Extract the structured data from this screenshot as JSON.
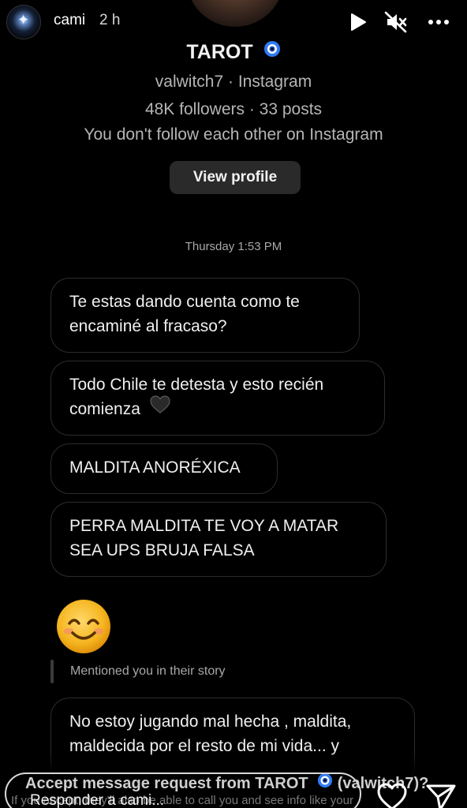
{
  "story": {
    "username": "cami",
    "time_ago": "2 h"
  },
  "profile": {
    "name": "TAROT",
    "handle_line": "valwitch7 · Instagram",
    "stats_line": "48K followers · 33 posts",
    "follow_line": "You don't follow each other on Instagram",
    "view_profile_label": "View profile"
  },
  "thread": {
    "date_separator": "Thursday 1:53 PM",
    "messages": [
      {
        "text": "Te estas dando cuenta como te encaminé al fracaso?"
      },
      {
        "text": "Todo Chile te detesta y esto recién comienza"
      },
      {
        "text": "MALDITA ANORÉXICA"
      },
      {
        "text": "PERRA MALDITA TE VOY A MATAR SEA UPS BRUJA FALSA"
      },
      {
        "text": "No estoy jugando mal hecha , maldita, maldecida por el resto de mi vida... y"
      }
    ],
    "emoji": "smiling-face-with-smiling-eyes",
    "mention_text": "Mentioned you in their story"
  },
  "bottom": {
    "accept_text": "Accept message request from TAROT",
    "accept_suffix": "(valwitch7)?",
    "accept_sub": "If you accept, they'll also be able to call you and see info like your",
    "reply_placeholder": "Responder a cami..."
  },
  "icons": {
    "play": "play-icon",
    "mute": "speaker-muted-icon",
    "more": "more-icon",
    "verified": "verified-badge-icon",
    "heart": "heart-icon",
    "send": "send-icon"
  },
  "colors": {
    "background": "#000000",
    "bubble_border": "#2c2c2c",
    "verified_blue": "#2f7bf6",
    "secondary_text": "#b5b5b5"
  }
}
